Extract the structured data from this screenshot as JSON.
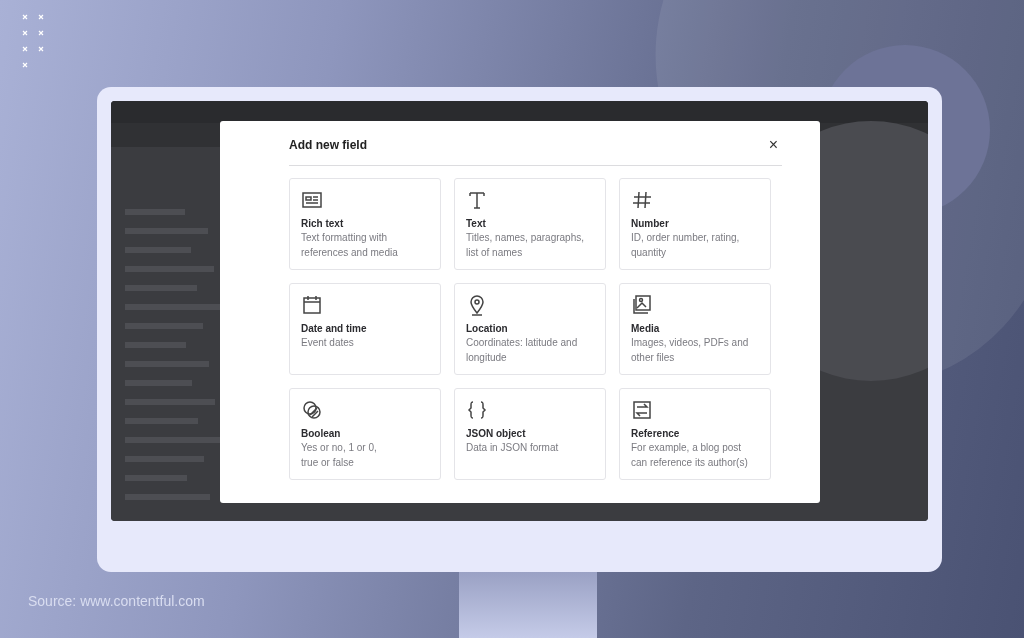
{
  "dialog": {
    "title": "Add new field",
    "close": "×"
  },
  "field_types": [
    {
      "kind": "rich-text",
      "title": "Rich text",
      "description_lines": [
        "Text formatting with",
        "references and media"
      ]
    },
    {
      "kind": "text",
      "title": "Text",
      "description_lines": [
        "Titles, names, paragraphs,",
        "list of names"
      ]
    },
    {
      "kind": "number",
      "title": "Number",
      "description_lines": [
        "ID, order number, rating,",
        "quantity"
      ]
    },
    {
      "kind": "date",
      "title": "Date and time",
      "description_lines": [
        "Event dates"
      ]
    },
    {
      "kind": "location",
      "title": "Location",
      "description_lines": [
        "Coordinates: latitude and",
        "longitude"
      ]
    },
    {
      "kind": "media",
      "title": "Media",
      "description_lines": [
        "Images, videos, PDFs and",
        "other files"
      ]
    },
    {
      "kind": "boolean",
      "title": "Boolean",
      "description_lines": [
        "Yes or no, 1 or 0,",
        "true or false"
      ]
    },
    {
      "kind": "json",
      "title": "JSON object",
      "description_lines": [
        "Data in JSON format"
      ]
    },
    {
      "kind": "reference",
      "title": "Reference",
      "description_lines": [
        "For example, a blog post",
        "can reference its author(s)"
      ]
    }
  ],
  "caption": "Source: www.contentful.com"
}
